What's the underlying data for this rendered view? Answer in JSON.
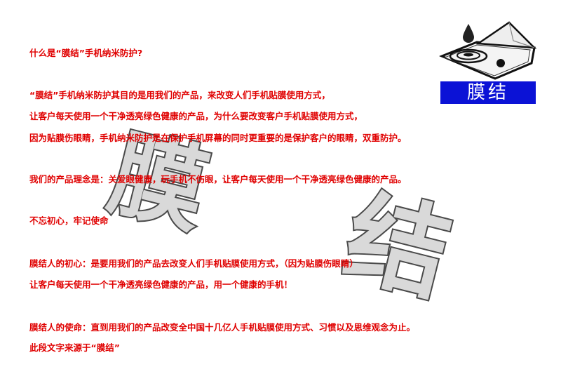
{
  "document": {
    "lines": [
      "什么是“膜结”手机纳米防护?",
      "“膜结”手机纳米防护其目的是用我们的产品，来改变人们手机贴膜使用方式，",
      "让客户每天使用一个干净透亮绿色健康的产品，为什么要改变客户手机贴膜使用方式，",
      "因为贴膜伤眼睛，手机纳米防护是在保护手机屏幕的同时更重要的是保护客户的眼睛，双重防护。",
      "我们的产品理念是：关爱眼健康，玩手机不伤眼，让客户每天使用一个干净透亮绿色健康的产品。",
      "不忘初心，牢记使命",
      "膜结人的初心：是要用我们的产品去改变人们手机贴膜使用方式，（因为贴膜伤眼睛）",
      "让客户每天使用一个干净透亮绿色健康的产品，用一个健康的手机！",
      "膜结人的使命：直到用我们的产品改变全中国十几亿人手机贴膜使用方式、习惯以及思维观念为止。",
      "此段文字来源于“膜结”"
    ]
  },
  "logo": {
    "label": "膜结"
  },
  "watermark": {
    "char1": "膜",
    "char2": "结"
  },
  "colors": {
    "text": "#e00000",
    "logo_background": "#0b12d6",
    "watermark_fill": "#d9d9d9",
    "watermark_stroke": "#4a4a4a"
  }
}
